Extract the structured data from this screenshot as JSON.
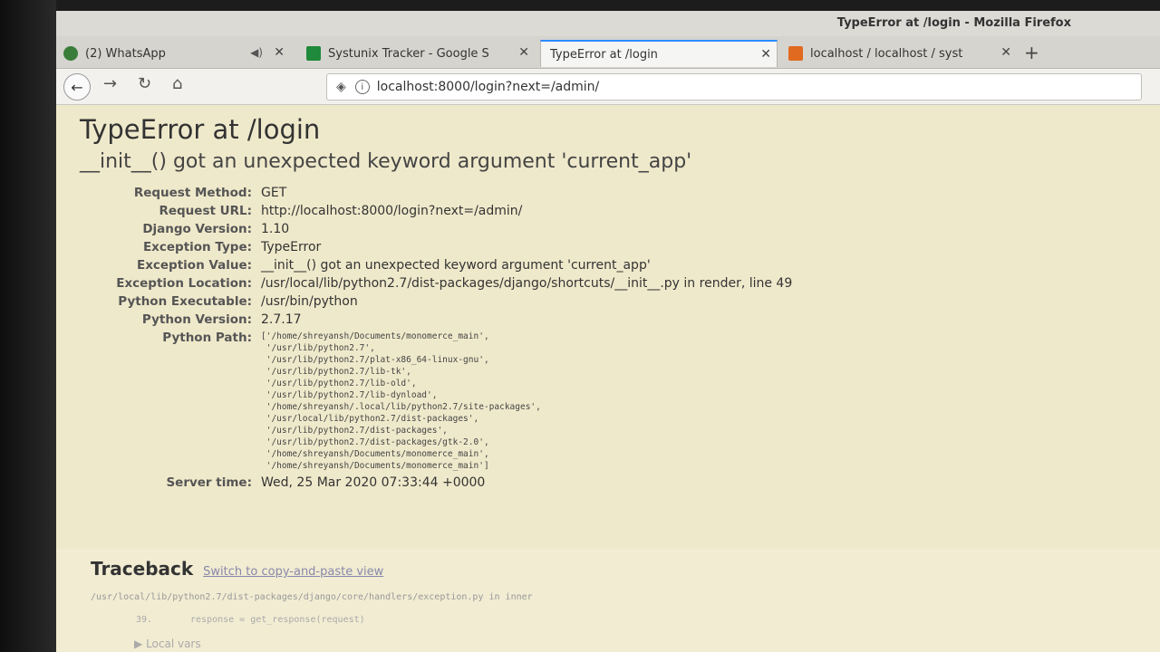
{
  "window": {
    "title": "TypeError at /login - Mozilla Firefox"
  },
  "tabs": [
    {
      "label": "(2) WhatsApp",
      "icon": "whatsapp-icon",
      "muted_icon": "speaker-icon"
    },
    {
      "label": "Systunix Tracker - Google S",
      "icon": "sheets-icon"
    },
    {
      "label": "TypeError at /login",
      "active": true
    },
    {
      "label": "localhost / localhost / syst",
      "icon": "phpmyadmin-icon"
    }
  ],
  "nav": {
    "url": "localhost:8000/login?next=/admin/"
  },
  "error": {
    "title": "TypeError at /login",
    "message": "__init__() got an unexpected keyword argument 'current_app'"
  },
  "meta": {
    "request_method_label": "Request Method:",
    "request_method": "GET",
    "request_url_label": "Request URL:",
    "request_url": "http://localhost:8000/login?next=/admin/",
    "django_version_label": "Django Version:",
    "django_version": "1.10",
    "exception_type_label": "Exception Type:",
    "exception_type": "TypeError",
    "exception_value_label": "Exception Value:",
    "exception_value": "__init__() got an unexpected keyword argument 'current_app'",
    "exception_location_label": "Exception Location:",
    "exception_location": "/usr/local/lib/python2.7/dist-packages/django/shortcuts/__init__.py in render, line 49",
    "python_executable_label": "Python Executable:",
    "python_executable": "/usr/bin/python",
    "python_version_label": "Python Version:",
    "python_version": "2.7.17",
    "python_path_label": "Python Path:",
    "python_path": [
      "['/home/shreyansh/Documents/monomerce_main',",
      " '/usr/lib/python2.7',",
      " '/usr/lib/python2.7/plat-x86_64-linux-gnu',",
      " '/usr/lib/python2.7/lib-tk',",
      " '/usr/lib/python2.7/lib-old',",
      " '/usr/lib/python2.7/lib-dynload',",
      " '/home/shreyansh/.local/lib/python2.7/site-packages',",
      " '/usr/local/lib/python2.7/dist-packages',",
      " '/usr/lib/python2.7/dist-packages',",
      " '/usr/lib/python2.7/dist-packages/gtk-2.0',",
      " '/home/shreyansh/Documents/monomerce_main',",
      " '/home/shreyansh/Documents/monomerce_main']"
    ],
    "server_time_label": "Server time:",
    "server_time": "Wed, 25 Mar 2020 07:33:44 +0000"
  },
  "traceback": {
    "title": "Traceback",
    "switch_link": "Switch to copy-and-paste view",
    "file": "/usr/local/lib/python2.7/dist-packages/django/core/handlers/exception.py in inner",
    "line_no": "39.",
    "line_code": "response = get_response(request)",
    "local_vars": "Local vars"
  }
}
